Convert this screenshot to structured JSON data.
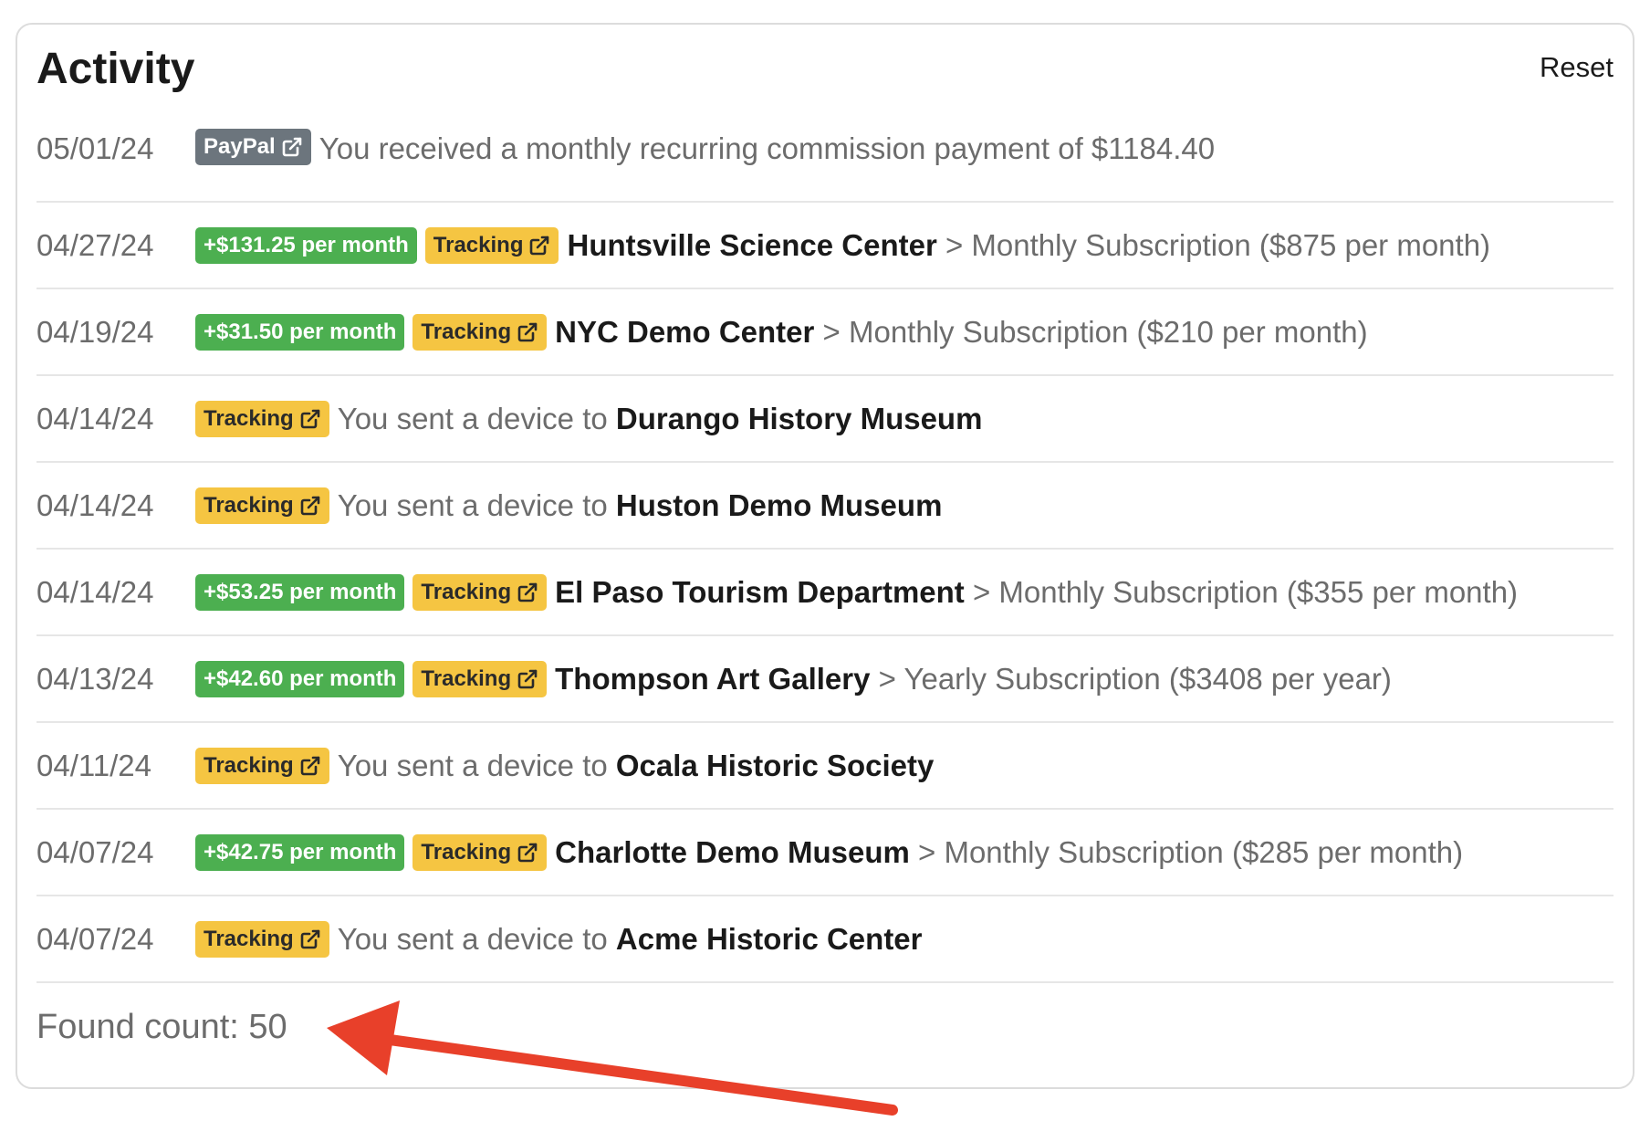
{
  "header": {
    "title": "Activity",
    "reset_label": "Reset"
  },
  "rows": [
    {
      "date": "05/01/24",
      "paypal_badge": "PayPal",
      "text": "You received a monthly recurring commission payment of $1184.40"
    },
    {
      "date": "04/27/24",
      "commission": "+$131.25 per month",
      "tracking": "Tracking",
      "org": "Huntsville Science Center",
      "detail": " > Monthly Subscription ($875 per month)"
    },
    {
      "date": "04/19/24",
      "commission": "+$31.50 per month",
      "tracking": "Tracking",
      "org": "NYC Demo Center",
      "detail": " > Monthly Subscription ($210 per month)"
    },
    {
      "date": "04/14/24",
      "tracking": "Tracking",
      "prefix": "You sent a device to ",
      "org": "Durango History Museum"
    },
    {
      "date": "04/14/24",
      "tracking": "Tracking",
      "prefix": "You sent a device to ",
      "org": "Huston Demo Museum"
    },
    {
      "date": "04/14/24",
      "commission": "+$53.25 per month",
      "tracking": "Tracking",
      "org": "El Paso Tourism Department",
      "detail": " > Monthly Subscription ($355 per month)"
    },
    {
      "date": "04/13/24",
      "commission": "+$42.60 per month",
      "tracking": "Tracking",
      "org": "Thompson Art Gallery",
      "detail": " > Yearly Subscription ($3408 per year)"
    },
    {
      "date": "04/11/24",
      "tracking": "Tracking",
      "prefix": "You sent a device to ",
      "org": "Ocala Historic Society"
    },
    {
      "date": "04/07/24",
      "commission": "+$42.75 per month",
      "tracking": "Tracking",
      "org": "Charlotte Demo Museum",
      "detail": " > Monthly Subscription ($285 per month)"
    },
    {
      "date": "04/07/24",
      "tracking": "Tracking",
      "prefix": "You sent a device to ",
      "org": "Acme Historic Center"
    }
  ],
  "footer": {
    "found_count": "Found count: 50"
  },
  "colors": {
    "green_badge": "#4caf50",
    "yellow_badge": "#f5c542",
    "gray_badge": "#6c757d",
    "annotation_arrow": "#e8402a"
  },
  "icons": {
    "badge_link": "external-link-icon",
    "annotation": "red-arrow-annotation"
  }
}
